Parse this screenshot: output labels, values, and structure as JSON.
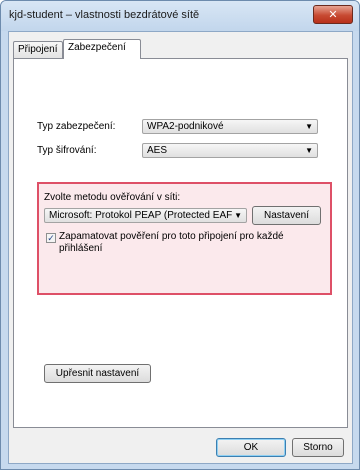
{
  "window": {
    "title": "kjd-student – vlastnosti bezdrátové sítě",
    "close_glyph": "✕"
  },
  "tabs": [
    {
      "label": "Připojení"
    },
    {
      "label": "Zabezpečení"
    }
  ],
  "security": {
    "type_label": "Typ zabezpečení:",
    "type_value": "WPA2-podnikové",
    "encryption_label": "Typ šifrování:",
    "encryption_value": "AES"
  },
  "auth": {
    "group_label": "Zvolte metodu ověřování v síti:",
    "method_value": "Microsoft: Protokol PEAP (Protected EAF",
    "settings_button": "Nastavení",
    "remember_checked": true,
    "remember_label_line1": "Zapamatovat pověření pro toto připojení pro každé",
    "remember_label_line2": "přihlášení"
  },
  "advanced_button": "Upřesnit nastavení",
  "footer": {
    "ok_button": "OK",
    "cancel_button": "Storno"
  },
  "icons": {
    "combo_arrow": "▼",
    "checkmark": "✓"
  }
}
